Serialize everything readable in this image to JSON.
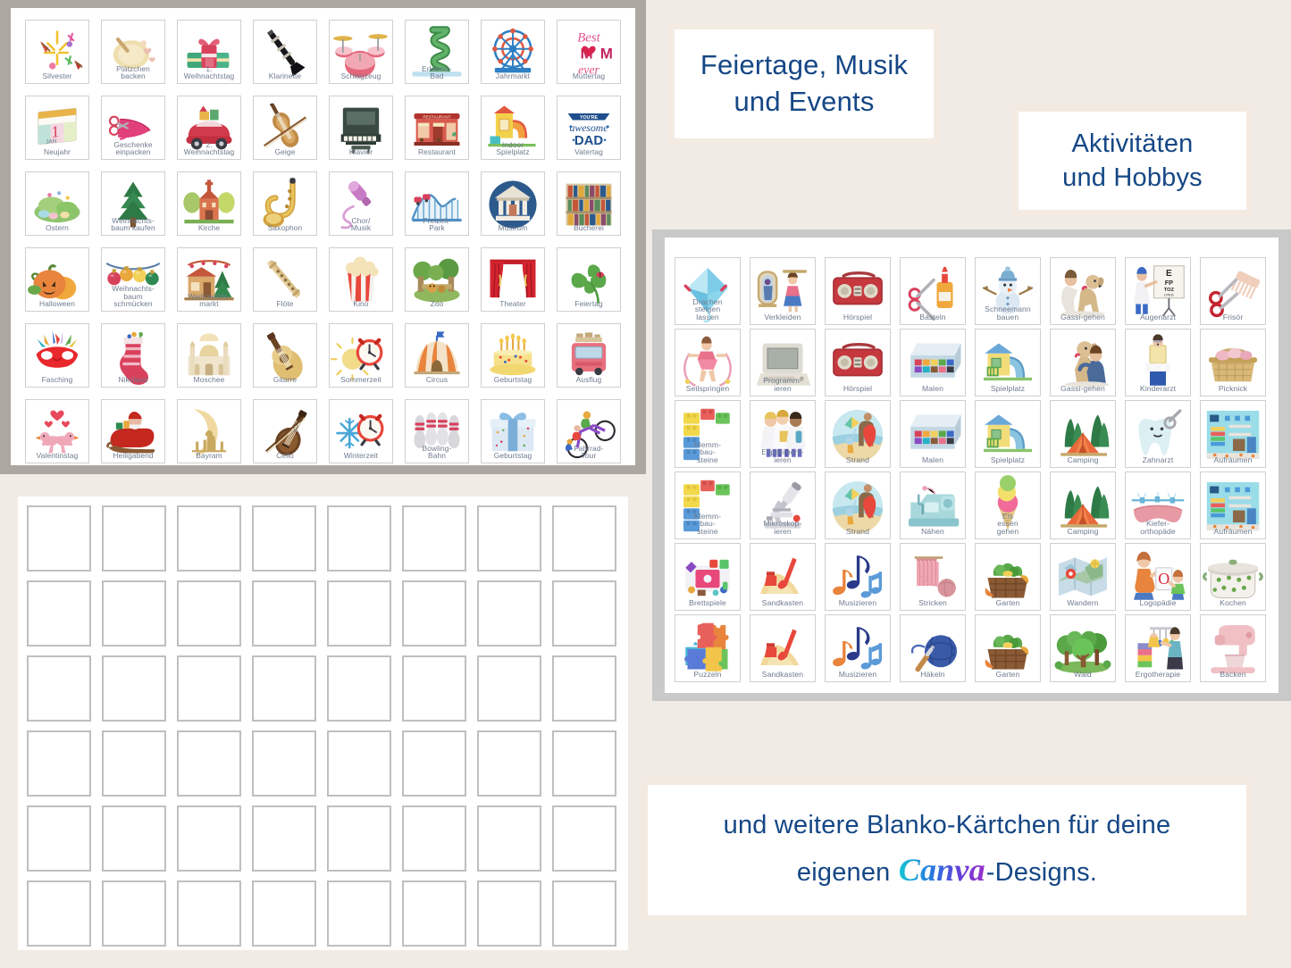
{
  "page": {
    "background": "#F0EBE5",
    "mat_gray": "#ACA8A1",
    "label_color": "#6E7B8E",
    "heading_color": "#154785",
    "heading_border": "#F3EAE2"
  },
  "headings": {
    "feiertage_line1": "Feiertage, Musik",
    "feiertage_line2": "und Events",
    "aktivitaeten_line1": "Aktivitäten",
    "aktivitaeten_line2": "und Hobbys"
  },
  "footer": {
    "line1": "und weitere Blanko-Kärtchen für deine",
    "line2_pre": "eigenen ",
    "brand": "Canva",
    "line2_post": "-Designs."
  },
  "feiertage_panel": {
    "columns": 8,
    "rows": 6,
    "cards": [
      {
        "label": "Silvester",
        "icon": "fireworks-icon"
      },
      {
        "label": "Plätzchen\nbacken",
        "icon": "cookie-dough-icon"
      },
      {
        "label": "1.\nWeihnachtstag",
        "icon": "gift-stack-icon"
      },
      {
        "label": "Klarinette",
        "icon": "clarinet-icon"
      },
      {
        "label": "Schlagzeug",
        "icon": "drum-kit-icon"
      },
      {
        "label": "Erlebnis-\nBad",
        "icon": "water-slide-icon"
      },
      {
        "label": "Jahrmarkt",
        "icon": "ferris-wheel-icon"
      },
      {
        "label": "Muttertag",
        "icon": "best-mom-ever-icon"
      },
      {
        "label": "Neujahr",
        "icon": "calendar-jan-icon"
      },
      {
        "label": "Geschenke\neinpacken",
        "icon": "scissors-ribbon-icon"
      },
      {
        "label": "2.\nWeihnachtstag",
        "icon": "christmas-car-icon"
      },
      {
        "label": "Geige",
        "icon": "violin-icon"
      },
      {
        "label": "Klavier",
        "icon": "piano-icon"
      },
      {
        "label": "Restaurant",
        "icon": "restaurant-icon"
      },
      {
        "label": "Indoor\nSpielplatz",
        "icon": "playground-slide-icon"
      },
      {
        "label": "Vatertag",
        "icon": "awesome-dad-icon"
      },
      {
        "label": "Ostern",
        "icon": "easter-meadow-icon"
      },
      {
        "label": "Weihnachts-\nbaum kaufen",
        "icon": "fir-tree-icon"
      },
      {
        "label": "Kirche",
        "icon": "church-icon"
      },
      {
        "label": "Saxophon",
        "icon": "saxophone-icon"
      },
      {
        "label": "Chor/\nMusik",
        "icon": "microphone-icon"
      },
      {
        "label": "Freizeit-\nPark",
        "icon": "roller-coaster-icon"
      },
      {
        "label": "Museum",
        "icon": "museum-icon"
      },
      {
        "label": "Bücherei",
        "icon": "bookshelf-icon"
      },
      {
        "label": "Halloween",
        "icon": "pumpkin-icon"
      },
      {
        "label": "Weihnachts-\nbaum\nschmücken",
        "icon": "baubles-icon"
      },
      {
        "label": "Weihnachts-\nmarkt",
        "icon": "christmas-market-icon"
      },
      {
        "label": "Flöte",
        "icon": "recorder-flute-icon"
      },
      {
        "label": "Kino",
        "icon": "popcorn-icon"
      },
      {
        "label": "Zoo",
        "icon": "zoo-icon"
      },
      {
        "label": "Theater",
        "icon": "stage-curtain-icon"
      },
      {
        "label": "Feiertag",
        "icon": "clover-icon"
      },
      {
        "label": "Fasching",
        "icon": "carnival-mask-icon"
      },
      {
        "label": "Nikolaus",
        "icon": "stocking-icon"
      },
      {
        "label": "Moschee",
        "icon": "mosque-icon"
      },
      {
        "label": "Gitarre",
        "icon": "guitar-icon"
      },
      {
        "label": "Sommerzeit",
        "icon": "sun-clock-icon"
      },
      {
        "label": "Circus",
        "icon": "circus-tent-icon"
      },
      {
        "label": "Geburtstag",
        "icon": "birthday-cake-icon"
      },
      {
        "label": "Ausflug",
        "icon": "bus-icon"
      },
      {
        "label": "Valentinstag",
        "icon": "love-birds-icon"
      },
      {
        "label": "Heiligabend",
        "icon": "santa-sleigh-icon"
      },
      {
        "label": "Bayram",
        "icon": "crescent-mosque-icon"
      },
      {
        "label": "Cello",
        "icon": "cello-icon"
      },
      {
        "label": "Winterzeit",
        "icon": "snowflake-clock-icon"
      },
      {
        "label": "Bowling-\nBahn",
        "icon": "bowling-pins-icon"
      },
      {
        "label": "Geburtstag",
        "icon": "gift-box-icon"
      },
      {
        "label": "Fahrrad-\nTour",
        "icon": "tandem-bike-icon"
      }
    ]
  },
  "aktivitaeten_panel": {
    "columns": 8,
    "rows": 6,
    "cards": [
      {
        "label": "Drachen\nsteigen\nlassen",
        "icon": "kite-icon"
      },
      {
        "label": "Verkleiden",
        "icon": "dress-up-icon"
      },
      {
        "label": "Hörspiel",
        "icon": "radio-icon"
      },
      {
        "label": "Basteln",
        "icon": "scissors-glue-icon"
      },
      {
        "label": "Schneemann\nbauen",
        "icon": "snowman-icon"
      },
      {
        "label": "Gassi-gehen",
        "icon": "dog-walk-icon"
      },
      {
        "label": "Augenarzt",
        "icon": "eye-chart-icon"
      },
      {
        "label": "Frisör",
        "icon": "comb-scissors-icon"
      },
      {
        "label": "Seilspringen",
        "icon": "jump-rope-icon"
      },
      {
        "label": "Programm-\nieren",
        "icon": "computer-icon"
      },
      {
        "label": "Hörspiel",
        "icon": "radio-icon"
      },
      {
        "label": "Malen",
        "icon": "paint-box-icon"
      },
      {
        "label": "Spielplatz",
        "icon": "playhouse-slide-icon"
      },
      {
        "label": "Gassi-gehen",
        "icon": "dog-hug-icon"
      },
      {
        "label": "Kinderarzt",
        "icon": "pediatrician-icon"
      },
      {
        "label": "Picknick",
        "icon": "picnic-basket-icon"
      },
      {
        "label": "Klemm-\nbau-\nsteine",
        "icon": "building-bricks-icon"
      },
      {
        "label": "Experiment-\nieren",
        "icon": "lab-kids-icon"
      },
      {
        "label": "Strand",
        "icon": "beach-icon"
      },
      {
        "label": "Malen",
        "icon": "paint-box-icon"
      },
      {
        "label": "Spielplatz",
        "icon": "playhouse-slide-icon"
      },
      {
        "label": "Camping",
        "icon": "tent-icon"
      },
      {
        "label": "Zahnarzt",
        "icon": "tooth-icon"
      },
      {
        "label": "Aufräumen",
        "icon": "tidy-room-icon"
      },
      {
        "label": "Klemm-\nbau-\nsteine",
        "icon": "building-bricks-icon"
      },
      {
        "label": "Mikroskop-\nieren",
        "icon": "microscope-icon"
      },
      {
        "label": "Strand",
        "icon": "beach-icon"
      },
      {
        "label": "Nähen",
        "icon": "sewing-machine-icon"
      },
      {
        "label": "Eis\nessen\ngehen",
        "icon": "ice-cream-icon"
      },
      {
        "label": "Camping",
        "icon": "tent-icon"
      },
      {
        "label": "Kiefer-\northopäde",
        "icon": "braces-icon"
      },
      {
        "label": "Aufräumen",
        "icon": "tidy-room-icon"
      },
      {
        "label": "Brettspiele",
        "icon": "board-game-icon"
      },
      {
        "label": "Sandkasten",
        "icon": "sandbox-icon"
      },
      {
        "label": "Musizieren",
        "icon": "music-notes-icon"
      },
      {
        "label": "Stricken",
        "icon": "knitting-icon"
      },
      {
        "label": "Garten",
        "icon": "vegetable-basket-icon"
      },
      {
        "label": "Wandern",
        "icon": "hiking-map-icon"
      },
      {
        "label": "Logopädie",
        "icon": "speech-therapy-icon"
      },
      {
        "label": "Kochen",
        "icon": "cooking-pot-icon"
      },
      {
        "label": "Puzzeln",
        "icon": "puzzle-icon"
      },
      {
        "label": "Sandkasten",
        "icon": "sandbox-icon"
      },
      {
        "label": "Musizieren",
        "icon": "music-notes-icon"
      },
      {
        "label": "Häkeln",
        "icon": "crochet-icon"
      },
      {
        "label": "Garten",
        "icon": "vegetable-basket-icon"
      },
      {
        "label": "Wald",
        "icon": "forest-icon"
      },
      {
        "label": "Ergotherapie",
        "icon": "occupational-therapy-icon"
      },
      {
        "label": "Backen",
        "icon": "stand-mixer-icon"
      }
    ]
  },
  "blank_panel": {
    "columns": 8,
    "rows": 6,
    "count": 48
  }
}
